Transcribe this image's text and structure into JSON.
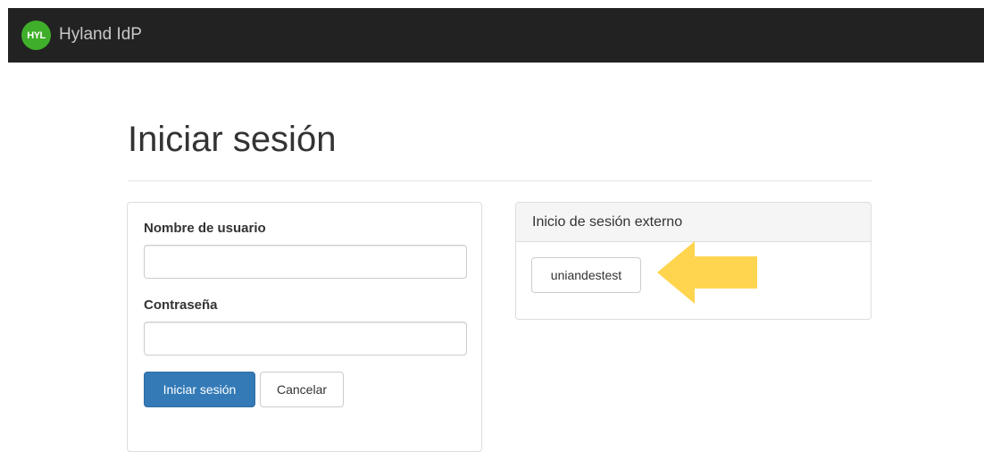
{
  "navbar": {
    "logo_text": "HYL",
    "brand_name": "Hyland IdP",
    "logo_color": "#3fae2a",
    "background": "#222222"
  },
  "page": {
    "title": "Iniciar sesión"
  },
  "login_form": {
    "username_label": "Nombre de usuario",
    "username_value": "",
    "password_label": "Contraseña",
    "password_value": "",
    "submit_label": "Iniciar sesión",
    "cancel_label": "Cancelar",
    "primary_color": "#337ab7"
  },
  "external_login": {
    "heading": "Inicio de sesión externo",
    "providers": [
      {
        "label": "uniandestest"
      }
    ]
  },
  "annotation": {
    "icon": "left-arrow-icon",
    "color": "#ffd54f"
  }
}
